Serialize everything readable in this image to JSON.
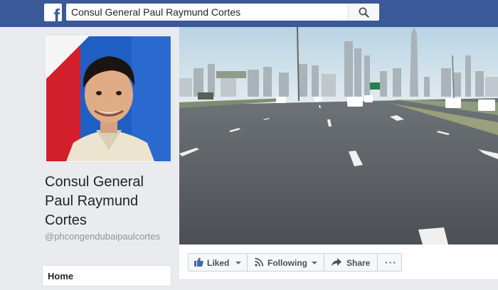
{
  "search": {
    "query": "Consul General Paul Raymund Cortes"
  },
  "icons": {
    "logo": "facebook-logo-icon",
    "search": "search-icon",
    "like": "thumbs-up-icon",
    "follow": "rss-icon",
    "share": "share-arrow-icon",
    "more": "more-dots-icon"
  },
  "profile": {
    "name": "Consul General Paul Raymund Cortes",
    "handle": "@phcongendubaipaulcortes"
  },
  "nav": {
    "items": [
      {
        "label": "Home"
      }
    ]
  },
  "actions": {
    "liked": "Liked",
    "following": "Following",
    "share": "Share",
    "more": "···"
  },
  "colors": {
    "brand": "#3b5998",
    "background": "#e9ebee"
  }
}
